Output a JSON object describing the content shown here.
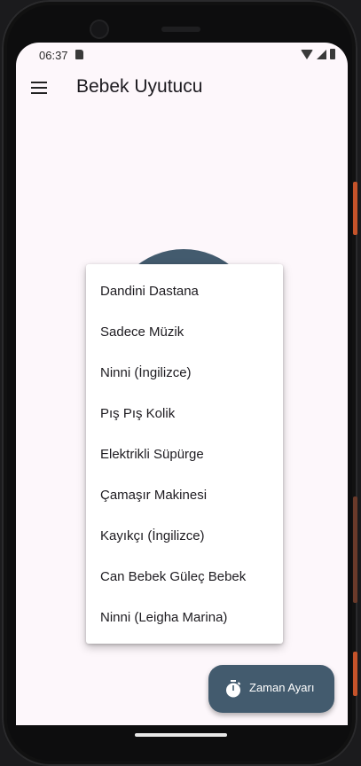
{
  "status_bar": {
    "time": "06:37",
    "icons": [
      "sim-card-icon",
      "wifi-icon",
      "signal-icon",
      "battery-icon"
    ]
  },
  "app_bar": {
    "title": "Bebek Uyutucu",
    "menu_icon": "hamburger-menu-icon"
  },
  "dropdown_menu": {
    "items": [
      "Dandini Dastana",
      "Sadece Müzik",
      "Ninni (İngilizce)",
      "Pış Pış Kolik",
      "Elektrikli Süpürge",
      "Çamaşır Makinesi",
      "Kayıkçı (İngilizce)",
      "Can Bebek Güleç Bebek",
      "Ninni (Leigha Marina)"
    ]
  },
  "fab": {
    "label": "Zaman Ayarı",
    "icon": "timer-icon"
  },
  "colors": {
    "accent": "#435b6e",
    "background": "#fdf7fb",
    "phone_side_button": "#c5532a"
  }
}
